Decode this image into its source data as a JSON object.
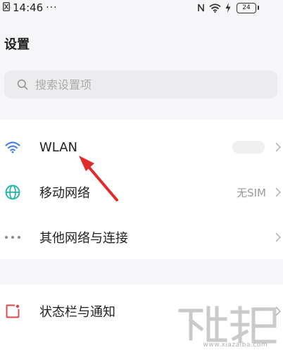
{
  "status_bar": {
    "time": "14:46",
    "dots": "···",
    "battery": "24",
    "icons": [
      "sim-icon",
      "nfc-icon",
      "wifi-icon",
      "charging-icon",
      "battery-icon"
    ]
  },
  "header": {
    "title": "设置"
  },
  "search": {
    "placeholder": "搜索设置项"
  },
  "settings_list": [
    {
      "label": "WLAN",
      "value": "",
      "icon": "wifi-icon"
    },
    {
      "label": "移动网络",
      "value": "无SIM",
      "icon": "globe-icon"
    },
    {
      "label": "其他网络与连接",
      "value": "",
      "icon": "more-dots-icon"
    }
  ],
  "settings_list_2": [
    {
      "label": "状态栏与通知",
      "value": "",
      "icon": "notification-icon"
    }
  ],
  "watermark": {
    "url": "www.xiazaiba.com"
  },
  "colors": {
    "wifi_blue": "#3a7be0",
    "globe_green": "#1fb7a5",
    "notification_red": "#e0454a",
    "arrow_red": "#e02b2b",
    "background": "#f6f6f8"
  }
}
